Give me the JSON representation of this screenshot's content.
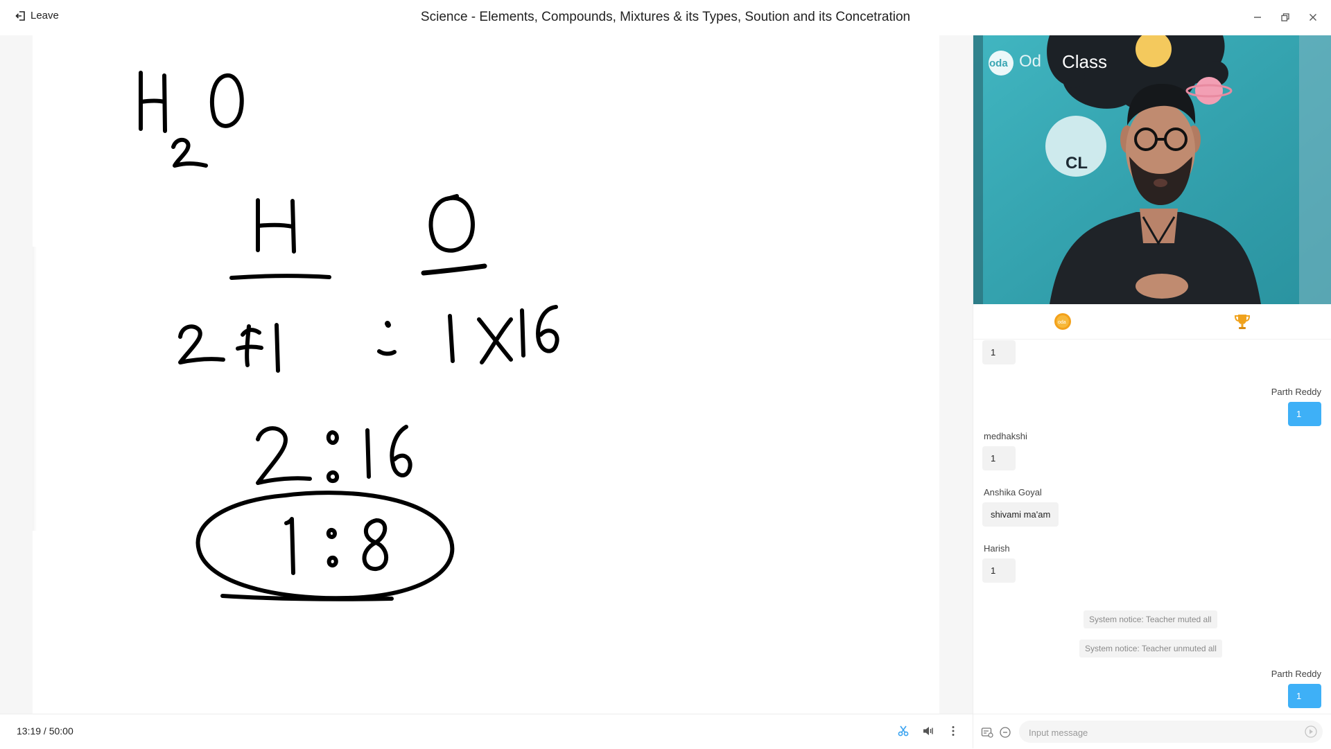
{
  "header": {
    "leave_label": "Leave",
    "title": "Science - Elements, Compounds, Mixtures & its Types, Soution and its Concetration"
  },
  "player": {
    "current_time": "13:19",
    "separator": " / ",
    "duration": "50:00"
  },
  "video": {
    "brand_text": "Class",
    "brand_prefix": "oda",
    "brand_partial": "Od",
    "backdrop_partial": "CL"
  },
  "chat": {
    "messages": [
      {
        "sender": "",
        "text": "1",
        "side": "left"
      },
      {
        "sender": "Parth Reddy",
        "text": "1",
        "side": "right"
      },
      {
        "sender": "medhakshi",
        "text": "1",
        "side": "left"
      },
      {
        "sender": "Anshika Goyal",
        "text": "shivami ma'am",
        "side": "left"
      },
      {
        "sender": "Harish",
        "text": "1",
        "side": "left"
      },
      {
        "sender": "Parth Reddy",
        "text": "1",
        "side": "right"
      }
    ],
    "notices": [
      "System notice: Teacher muted all",
      "System notice: Teacher unmuted all"
    ],
    "input_placeholder": "Input message"
  },
  "icons": {
    "tab_coin": "oda-coin-icon",
    "tab_trophy": "trophy-icon"
  },
  "colors": {
    "mine_bubble": "#3eb0f7",
    "coin": "#f3a11a",
    "trophy": "#f0a21c"
  }
}
